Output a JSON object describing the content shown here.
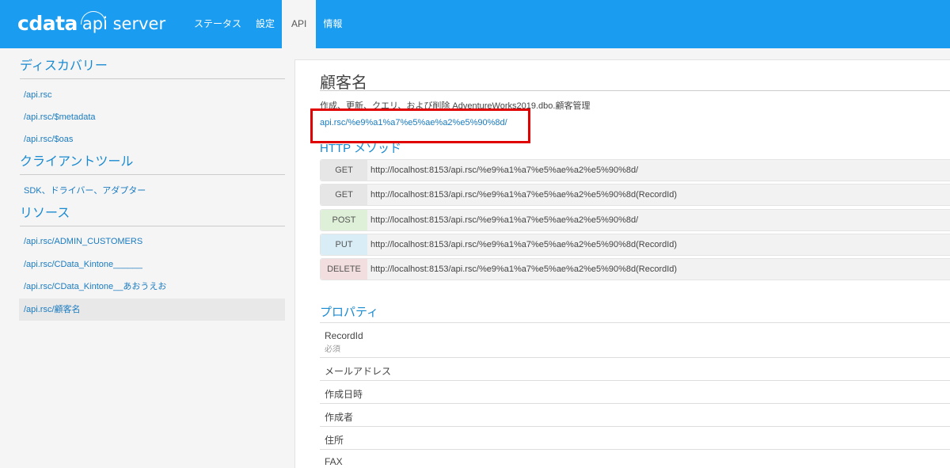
{
  "header": {
    "logo_mark": "cdata",
    "logo_sub": "api server",
    "nav": [
      {
        "label": "ステータス"
      },
      {
        "label": "設定"
      },
      {
        "label": "API"
      },
      {
        "label": "情報"
      }
    ]
  },
  "sidebar": {
    "discovery_title": "ディスカバリー",
    "discovery_links": [
      "/api.rsc",
      "/api.rsc/$metadata",
      "/api.rsc/$oas"
    ],
    "client_title": "クライアントツール",
    "client_links": [
      "SDK、ドライバー、アダプター"
    ],
    "resources_title": "リソース",
    "resource_links": [
      "/api.rsc/ADMIN_CUSTOMERS",
      "/api.rsc/CData_Kintone______",
      "/api.rsc/CData_Kintone__あおうえお",
      "/api.rsc/顧客名"
    ]
  },
  "main": {
    "title": "顧客名",
    "description": "作成、更新、クエリ、および削除 AdventureWorks2019.dbo.顧客管理",
    "url": "api.rsc/%e9%a1%a7%e5%ae%a2%e5%90%8d/",
    "methods_title": "HTTP メソッド",
    "methods": [
      {
        "method": "GET",
        "url": "http://localhost:8153/api.rsc/%e9%a1%a7%e5%ae%a2%e5%90%8d/"
      },
      {
        "method": "GET",
        "url": "http://localhost:8153/api.rsc/%e9%a1%a7%e5%ae%a2%e5%90%8d(RecordId)"
      },
      {
        "method": "POST",
        "url": "http://localhost:8153/api.rsc/%e9%a1%a7%e5%ae%a2%e5%90%8d/"
      },
      {
        "method": "PUT",
        "url": "http://localhost:8153/api.rsc/%e9%a1%a7%e5%ae%a2%e5%90%8d(RecordId)"
      },
      {
        "method": "DELETE",
        "url": "http://localhost:8153/api.rsc/%e9%a1%a7%e5%ae%a2%e5%90%8d(RecordId)"
      }
    ],
    "properties_title": "プロパティ",
    "properties": [
      {
        "name": "RecordId",
        "required": "必須"
      },
      {
        "name": "メールアドレス"
      },
      {
        "name": "作成日時"
      },
      {
        "name": "作成者"
      },
      {
        "name": "住所"
      },
      {
        "name": "FAX"
      }
    ]
  },
  "colors": {
    "header_bg": "#1a9cf0",
    "link": "#1a7bc0",
    "highlight": "#e00000"
  }
}
